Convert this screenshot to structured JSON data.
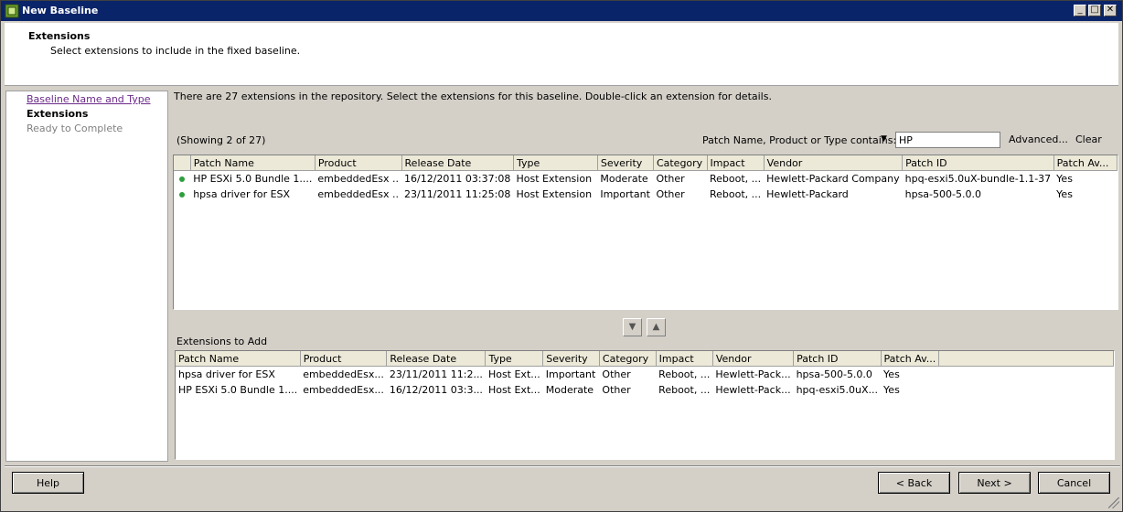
{
  "window": {
    "title": "New Baseline"
  },
  "header": {
    "title": "Extensions",
    "subtitle": "Select extensions to include in the fixed baseline."
  },
  "nav": {
    "items": [
      "Baseline Name and Type",
      "Extensions",
      "Ready to Complete"
    ]
  },
  "repository": {
    "info": "There are 27 extensions in the repository. Select the extensions for this baseline. Double-click an extension for details.",
    "showing": "(Showing 2 of 27)",
    "filter_label": "Patch Name, Product or Type contains:",
    "filter_value": "HP",
    "advanced_label": "Advanced...",
    "clear_label": "Clear",
    "columns": [
      "Patch Name",
      "Product",
      "Release Date",
      "Type",
      "Severity",
      "Category",
      "Impact",
      "Vendor",
      "Patch ID",
      "Patch Av..."
    ],
    "rows": [
      [
        "HP ESXi 5.0 Bundle 1....",
        "embeddedEsx ..",
        "16/12/2011 03:37:08",
        "Host Extension",
        "Moderate",
        "Other",
        "Reboot, ...",
        "Hewlett-Packard Company",
        "hpq-esxi5.0uX-bundle-1.1-37",
        "Yes"
      ],
      [
        "hpsa driver for ESX",
        "embeddedEsx ..",
        "23/11/2011 11:25:08",
        "Host Extension",
        "Important",
        "Other",
        "Reboot, ...",
        "Hewlett-Packard",
        "hpsa-500-5.0.0",
        "Yes"
      ]
    ]
  },
  "to_add": {
    "label": "Extensions to Add",
    "columns": [
      "Patch Name",
      "Product",
      "Release Date",
      "Type",
      "Severity",
      "Category",
      "Impact",
      "Vendor",
      "Patch ID",
      "Patch Av..."
    ],
    "rows": [
      [
        "hpsa driver for ESX",
        "embeddedEsx...",
        "23/11/2011 11:2...",
        "Host Ext...",
        "Important",
        "Other",
        "Reboot, ...",
        "Hewlett-Pack...",
        "hpsa-500-5.0.0",
        "Yes"
      ],
      [
        "HP ESXi 5.0 Bundle 1....",
        "embeddedEsx...",
        "16/12/2011 03:3...",
        "Host Ext...",
        "Moderate",
        "Other",
        "Reboot, ...",
        "Hewlett-Pack...",
        "hpq-esxi5.0uX...",
        "Yes"
      ]
    ]
  },
  "footer": {
    "help": "Help",
    "back": "< Back",
    "next": "Next >",
    "cancel": "Cancel"
  },
  "colors": {
    "titlebar": "#0a246a",
    "status_dot": "#2f9e3e",
    "link": "#6b2a8a"
  },
  "icons": [
    "app-icon",
    "minimize-icon",
    "maximize-icon",
    "close-icon",
    "move-down-icon",
    "move-up-icon",
    "status-dot-icon",
    "resize-grip-icon"
  ]
}
